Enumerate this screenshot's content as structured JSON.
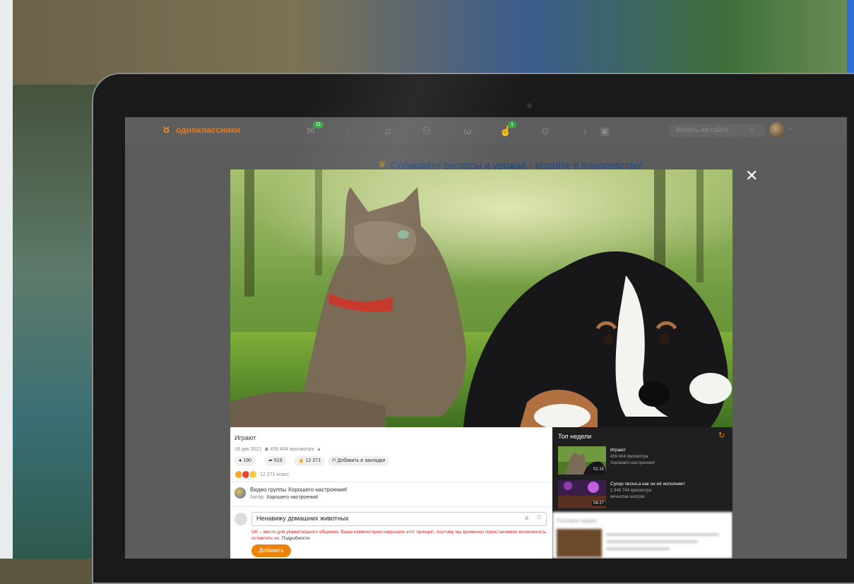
{
  "header": {
    "logo_text": "одноклассники",
    "nav_badges": {
      "messages": "11",
      "likes": "1"
    },
    "search_placeholder": "Искать на сайте"
  },
  "banner": {
    "text": "Собирайте ресурсы и урожай - играйте в Королевство!"
  },
  "video": {
    "title": "Играют",
    "date": "18 дек 2021",
    "views": "459 404 просмотра",
    "comments": "190",
    "shares": "519",
    "likes": "12 271",
    "bookmark_label": "Добавить в закладки",
    "reaction_count": "12 271 класс"
  },
  "group": {
    "title": "Видео группы Хорошего настроения!",
    "author_label": "Автор:",
    "author_name": "Хорошего настроения!"
  },
  "comment": {
    "value": "Ненавижу домашних животных",
    "warning": "OK – место для уважительного общения. Ваши комментарии нарушали этот принцип, поэтому мы временно приостановили возможность оставлять их.",
    "more": "Подробности",
    "add_button": "Добавить"
  },
  "top_week": {
    "title": "Топ недели",
    "items": [
      {
        "title": "Играют",
        "views": "459 404 просмотра",
        "author": "Хорошего настроения!",
        "duration": "01:15"
      },
      {
        "title": "Супер песня,а как он её исполняет",
        "views": "1 848 744 просмотра",
        "author": "вячеслав шатров",
        "duration": "04:27"
      }
    ]
  },
  "similar": {
    "title": "Похожие видео"
  },
  "colors": {
    "accent": "#ee8208",
    "warning": "#e01c1c",
    "badge": "#3aa648"
  }
}
